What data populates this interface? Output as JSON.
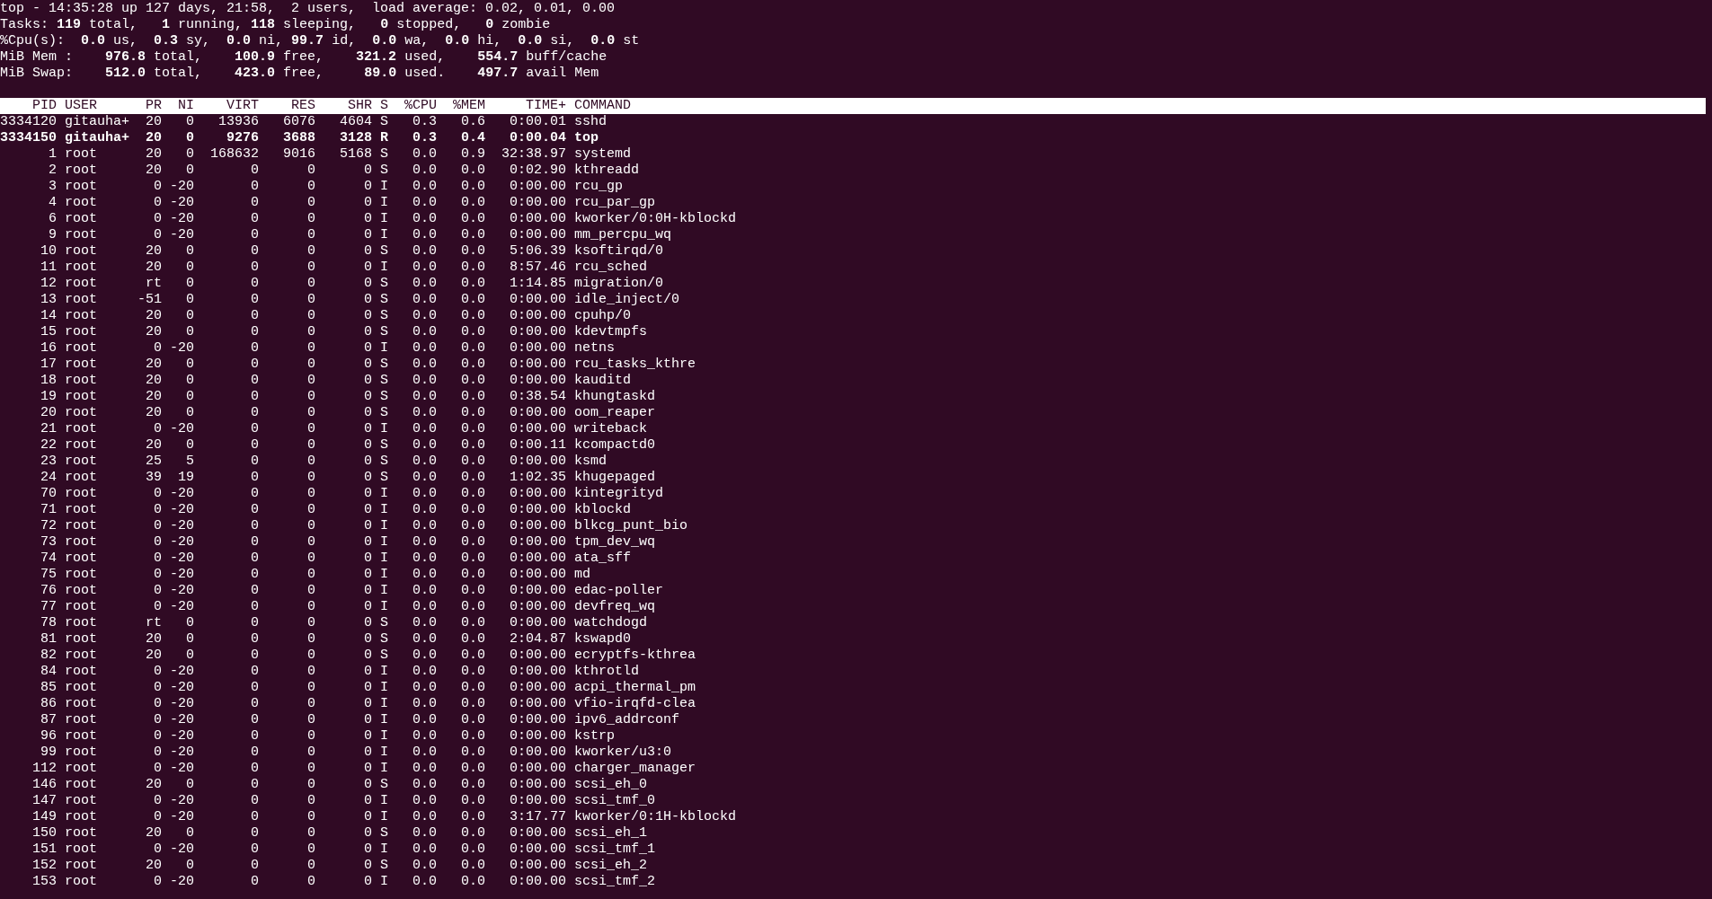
{
  "summary": [
    "top - 14:35:28 up 127 days, 21:58,  2 users,  load average: 0.02, 0.01, 0.00",
    "Tasks: **119** total,   **1** running, **118** sleeping,   **0** stopped,   **0** zombie",
    "%Cpu(s):  **0.0** us,  **0.3** sy,  **0.0** ni, **99.7** id,  **0.0** wa,  **0.0** hi,  **0.0** si,  **0.0** st",
    "MiB Mem :    **976.8** total,    **100.9** free,    **321.2** used,    **554.7** buff/cache",
    "MiB Swap:    **512.0** total,    **423.0** free,     **89.0** used.    **497.7** avail Mem"
  ],
  "table": {
    "columns": [
      "PID",
      "USER",
      "PR",
      "NI",
      "VIRT",
      "RES",
      "SHR",
      "S",
      "%CPU",
      "%MEM",
      "TIME+",
      "COMMAND"
    ],
    "rows": [
      {
        "bold": false,
        "cells": [
          "3334120",
          "gitauha+",
          "20",
          "0",
          "13936",
          "6076",
          "4604",
          "S",
          "0.3",
          "0.6",
          "0:00.01",
          "sshd"
        ]
      },
      {
        "bold": true,
        "cells": [
          "3334150",
          "gitauha+",
          "20",
          "0",
          "9276",
          "3688",
          "3128",
          "R",
          "0.3",
          "0.4",
          "0:00.04",
          "top"
        ]
      },
      {
        "bold": false,
        "cells": [
          "1",
          "root",
          "20",
          "0",
          "168632",
          "9016",
          "5168",
          "S",
          "0.0",
          "0.9",
          "32:38.97",
          "systemd"
        ]
      },
      {
        "bold": false,
        "cells": [
          "2",
          "root",
          "20",
          "0",
          "0",
          "0",
          "0",
          "S",
          "0.0",
          "0.0",
          "0:02.90",
          "kthreadd"
        ]
      },
      {
        "bold": false,
        "cells": [
          "3",
          "root",
          "0",
          "-20",
          "0",
          "0",
          "0",
          "I",
          "0.0",
          "0.0",
          "0:00.00",
          "rcu_gp"
        ]
      },
      {
        "bold": false,
        "cells": [
          "4",
          "root",
          "0",
          "-20",
          "0",
          "0",
          "0",
          "I",
          "0.0",
          "0.0",
          "0:00.00",
          "rcu_par_gp"
        ]
      },
      {
        "bold": false,
        "cells": [
          "6",
          "root",
          "0",
          "-20",
          "0",
          "0",
          "0",
          "I",
          "0.0",
          "0.0",
          "0:00.00",
          "kworker/0:0H-kblockd"
        ]
      },
      {
        "bold": false,
        "cells": [
          "9",
          "root",
          "0",
          "-20",
          "0",
          "0",
          "0",
          "I",
          "0.0",
          "0.0",
          "0:00.00",
          "mm_percpu_wq"
        ]
      },
      {
        "bold": false,
        "cells": [
          "10",
          "root",
          "20",
          "0",
          "0",
          "0",
          "0",
          "S",
          "0.0",
          "0.0",
          "5:06.39",
          "ksoftirqd/0"
        ]
      },
      {
        "bold": false,
        "cells": [
          "11",
          "root",
          "20",
          "0",
          "0",
          "0",
          "0",
          "I",
          "0.0",
          "0.0",
          "8:57.46",
          "rcu_sched"
        ]
      },
      {
        "bold": false,
        "cells": [
          "12",
          "root",
          "rt",
          "0",
          "0",
          "0",
          "0",
          "S",
          "0.0",
          "0.0",
          "1:14.85",
          "migration/0"
        ]
      },
      {
        "bold": false,
        "cells": [
          "13",
          "root",
          "-51",
          "0",
          "0",
          "0",
          "0",
          "S",
          "0.0",
          "0.0",
          "0:00.00",
          "idle_inject/0"
        ]
      },
      {
        "bold": false,
        "cells": [
          "14",
          "root",
          "20",
          "0",
          "0",
          "0",
          "0",
          "S",
          "0.0",
          "0.0",
          "0:00.00",
          "cpuhp/0"
        ]
      },
      {
        "bold": false,
        "cells": [
          "15",
          "root",
          "20",
          "0",
          "0",
          "0",
          "0",
          "S",
          "0.0",
          "0.0",
          "0:00.00",
          "kdevtmpfs"
        ]
      },
      {
        "bold": false,
        "cells": [
          "16",
          "root",
          "0",
          "-20",
          "0",
          "0",
          "0",
          "I",
          "0.0",
          "0.0",
          "0:00.00",
          "netns"
        ]
      },
      {
        "bold": false,
        "cells": [
          "17",
          "root",
          "20",
          "0",
          "0",
          "0",
          "0",
          "S",
          "0.0",
          "0.0",
          "0:00.00",
          "rcu_tasks_kthre"
        ]
      },
      {
        "bold": false,
        "cells": [
          "18",
          "root",
          "20",
          "0",
          "0",
          "0",
          "0",
          "S",
          "0.0",
          "0.0",
          "0:00.00",
          "kauditd"
        ]
      },
      {
        "bold": false,
        "cells": [
          "19",
          "root",
          "20",
          "0",
          "0",
          "0",
          "0",
          "S",
          "0.0",
          "0.0",
          "0:38.54",
          "khungtaskd"
        ]
      },
      {
        "bold": false,
        "cells": [
          "20",
          "root",
          "20",
          "0",
          "0",
          "0",
          "0",
          "S",
          "0.0",
          "0.0",
          "0:00.00",
          "oom_reaper"
        ]
      },
      {
        "bold": false,
        "cells": [
          "21",
          "root",
          "0",
          "-20",
          "0",
          "0",
          "0",
          "I",
          "0.0",
          "0.0",
          "0:00.00",
          "writeback"
        ]
      },
      {
        "bold": false,
        "cells": [
          "22",
          "root",
          "20",
          "0",
          "0",
          "0",
          "0",
          "S",
          "0.0",
          "0.0",
          "0:00.11",
          "kcompactd0"
        ]
      },
      {
        "bold": false,
        "cells": [
          "23",
          "root",
          "25",
          "5",
          "0",
          "0",
          "0",
          "S",
          "0.0",
          "0.0",
          "0:00.00",
          "ksmd"
        ]
      },
      {
        "bold": false,
        "cells": [
          "24",
          "root",
          "39",
          "19",
          "0",
          "0",
          "0",
          "S",
          "0.0",
          "0.0",
          "1:02.35",
          "khugepaged"
        ]
      },
      {
        "bold": false,
        "cells": [
          "70",
          "root",
          "0",
          "-20",
          "0",
          "0",
          "0",
          "I",
          "0.0",
          "0.0",
          "0:00.00",
          "kintegrityd"
        ]
      },
      {
        "bold": false,
        "cells": [
          "71",
          "root",
          "0",
          "-20",
          "0",
          "0",
          "0",
          "I",
          "0.0",
          "0.0",
          "0:00.00",
          "kblockd"
        ]
      },
      {
        "bold": false,
        "cells": [
          "72",
          "root",
          "0",
          "-20",
          "0",
          "0",
          "0",
          "I",
          "0.0",
          "0.0",
          "0:00.00",
          "blkcg_punt_bio"
        ]
      },
      {
        "bold": false,
        "cells": [
          "73",
          "root",
          "0",
          "-20",
          "0",
          "0",
          "0",
          "I",
          "0.0",
          "0.0",
          "0:00.00",
          "tpm_dev_wq"
        ]
      },
      {
        "bold": false,
        "cells": [
          "74",
          "root",
          "0",
          "-20",
          "0",
          "0",
          "0",
          "I",
          "0.0",
          "0.0",
          "0:00.00",
          "ata_sff"
        ]
      },
      {
        "bold": false,
        "cells": [
          "75",
          "root",
          "0",
          "-20",
          "0",
          "0",
          "0",
          "I",
          "0.0",
          "0.0",
          "0:00.00",
          "md"
        ]
      },
      {
        "bold": false,
        "cells": [
          "76",
          "root",
          "0",
          "-20",
          "0",
          "0",
          "0",
          "I",
          "0.0",
          "0.0",
          "0:00.00",
          "edac-poller"
        ]
      },
      {
        "bold": false,
        "cells": [
          "77",
          "root",
          "0",
          "-20",
          "0",
          "0",
          "0",
          "I",
          "0.0",
          "0.0",
          "0:00.00",
          "devfreq_wq"
        ]
      },
      {
        "bold": false,
        "cells": [
          "78",
          "root",
          "rt",
          "0",
          "0",
          "0",
          "0",
          "S",
          "0.0",
          "0.0",
          "0:00.00",
          "watchdogd"
        ]
      },
      {
        "bold": false,
        "cells": [
          "81",
          "root",
          "20",
          "0",
          "0",
          "0",
          "0",
          "S",
          "0.0",
          "0.0",
          "2:04.87",
          "kswapd0"
        ]
      },
      {
        "bold": false,
        "cells": [
          "82",
          "root",
          "20",
          "0",
          "0",
          "0",
          "0",
          "S",
          "0.0",
          "0.0",
          "0:00.00",
          "ecryptfs-kthrea"
        ]
      },
      {
        "bold": false,
        "cells": [
          "84",
          "root",
          "0",
          "-20",
          "0",
          "0",
          "0",
          "I",
          "0.0",
          "0.0",
          "0:00.00",
          "kthrotld"
        ]
      },
      {
        "bold": false,
        "cells": [
          "85",
          "root",
          "0",
          "-20",
          "0",
          "0",
          "0",
          "I",
          "0.0",
          "0.0",
          "0:00.00",
          "acpi_thermal_pm"
        ]
      },
      {
        "bold": false,
        "cells": [
          "86",
          "root",
          "0",
          "-20",
          "0",
          "0",
          "0",
          "I",
          "0.0",
          "0.0",
          "0:00.00",
          "vfio-irqfd-clea"
        ]
      },
      {
        "bold": false,
        "cells": [
          "87",
          "root",
          "0",
          "-20",
          "0",
          "0",
          "0",
          "I",
          "0.0",
          "0.0",
          "0:00.00",
          "ipv6_addrconf"
        ]
      },
      {
        "bold": false,
        "cells": [
          "96",
          "root",
          "0",
          "-20",
          "0",
          "0",
          "0",
          "I",
          "0.0",
          "0.0",
          "0:00.00",
          "kstrp"
        ]
      },
      {
        "bold": false,
        "cells": [
          "99",
          "root",
          "0",
          "-20",
          "0",
          "0",
          "0",
          "I",
          "0.0",
          "0.0",
          "0:00.00",
          "kworker/u3:0"
        ]
      },
      {
        "bold": false,
        "cells": [
          "112",
          "root",
          "0",
          "-20",
          "0",
          "0",
          "0",
          "I",
          "0.0",
          "0.0",
          "0:00.00",
          "charger_manager"
        ]
      },
      {
        "bold": false,
        "cells": [
          "146",
          "root",
          "20",
          "0",
          "0",
          "0",
          "0",
          "S",
          "0.0",
          "0.0",
          "0:00.00",
          "scsi_eh_0"
        ]
      },
      {
        "bold": false,
        "cells": [
          "147",
          "root",
          "0",
          "-20",
          "0",
          "0",
          "0",
          "I",
          "0.0",
          "0.0",
          "0:00.00",
          "scsi_tmf_0"
        ]
      },
      {
        "bold": false,
        "cells": [
          "149",
          "root",
          "0",
          "-20",
          "0",
          "0",
          "0",
          "I",
          "0.0",
          "0.0",
          "3:17.77",
          "kworker/0:1H-kblockd"
        ]
      },
      {
        "bold": false,
        "cells": [
          "150",
          "root",
          "20",
          "0",
          "0",
          "0",
          "0",
          "S",
          "0.0",
          "0.0",
          "0:00.00",
          "scsi_eh_1"
        ]
      },
      {
        "bold": false,
        "cells": [
          "151",
          "root",
          "0",
          "-20",
          "0",
          "0",
          "0",
          "I",
          "0.0",
          "0.0",
          "0:00.00",
          "scsi_tmf_1"
        ]
      },
      {
        "bold": false,
        "cells": [
          "152",
          "root",
          "20",
          "0",
          "0",
          "0",
          "0",
          "S",
          "0.0",
          "0.0",
          "0:00.00",
          "scsi_eh_2"
        ]
      },
      {
        "bold": false,
        "cells": [
          "153",
          "root",
          "0",
          "-20",
          "0",
          "0",
          "0",
          "I",
          "0.0",
          "0.0",
          "0:00.00",
          "scsi_tmf_2"
        ]
      }
    ]
  }
}
